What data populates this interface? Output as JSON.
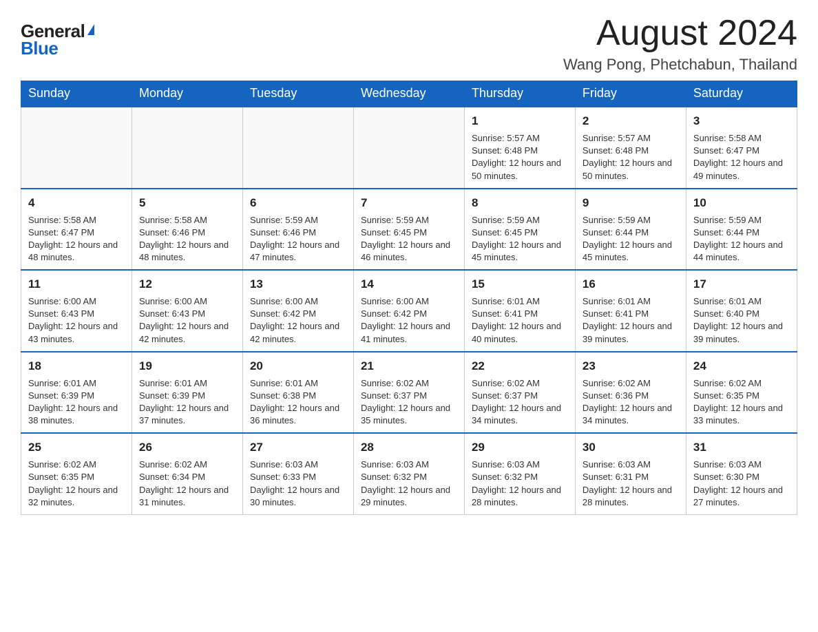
{
  "header": {
    "logo_general": "General",
    "logo_blue": "Blue",
    "month_title": "August 2024",
    "location": "Wang Pong, Phetchabun, Thailand"
  },
  "weekdays": [
    "Sunday",
    "Monday",
    "Tuesday",
    "Wednesday",
    "Thursday",
    "Friday",
    "Saturday"
  ],
  "weeks": [
    [
      {
        "day": "",
        "info": ""
      },
      {
        "day": "",
        "info": ""
      },
      {
        "day": "",
        "info": ""
      },
      {
        "day": "",
        "info": ""
      },
      {
        "day": "1",
        "info": "Sunrise: 5:57 AM\nSunset: 6:48 PM\nDaylight: 12 hours and 50 minutes."
      },
      {
        "day": "2",
        "info": "Sunrise: 5:57 AM\nSunset: 6:48 PM\nDaylight: 12 hours and 50 minutes."
      },
      {
        "day": "3",
        "info": "Sunrise: 5:58 AM\nSunset: 6:47 PM\nDaylight: 12 hours and 49 minutes."
      }
    ],
    [
      {
        "day": "4",
        "info": "Sunrise: 5:58 AM\nSunset: 6:47 PM\nDaylight: 12 hours and 48 minutes."
      },
      {
        "day": "5",
        "info": "Sunrise: 5:58 AM\nSunset: 6:46 PM\nDaylight: 12 hours and 48 minutes."
      },
      {
        "day": "6",
        "info": "Sunrise: 5:59 AM\nSunset: 6:46 PM\nDaylight: 12 hours and 47 minutes."
      },
      {
        "day": "7",
        "info": "Sunrise: 5:59 AM\nSunset: 6:45 PM\nDaylight: 12 hours and 46 minutes."
      },
      {
        "day": "8",
        "info": "Sunrise: 5:59 AM\nSunset: 6:45 PM\nDaylight: 12 hours and 45 minutes."
      },
      {
        "day": "9",
        "info": "Sunrise: 5:59 AM\nSunset: 6:44 PM\nDaylight: 12 hours and 45 minutes."
      },
      {
        "day": "10",
        "info": "Sunrise: 5:59 AM\nSunset: 6:44 PM\nDaylight: 12 hours and 44 minutes."
      }
    ],
    [
      {
        "day": "11",
        "info": "Sunrise: 6:00 AM\nSunset: 6:43 PM\nDaylight: 12 hours and 43 minutes."
      },
      {
        "day": "12",
        "info": "Sunrise: 6:00 AM\nSunset: 6:43 PM\nDaylight: 12 hours and 42 minutes."
      },
      {
        "day": "13",
        "info": "Sunrise: 6:00 AM\nSunset: 6:42 PM\nDaylight: 12 hours and 42 minutes."
      },
      {
        "day": "14",
        "info": "Sunrise: 6:00 AM\nSunset: 6:42 PM\nDaylight: 12 hours and 41 minutes."
      },
      {
        "day": "15",
        "info": "Sunrise: 6:01 AM\nSunset: 6:41 PM\nDaylight: 12 hours and 40 minutes."
      },
      {
        "day": "16",
        "info": "Sunrise: 6:01 AM\nSunset: 6:41 PM\nDaylight: 12 hours and 39 minutes."
      },
      {
        "day": "17",
        "info": "Sunrise: 6:01 AM\nSunset: 6:40 PM\nDaylight: 12 hours and 39 minutes."
      }
    ],
    [
      {
        "day": "18",
        "info": "Sunrise: 6:01 AM\nSunset: 6:39 PM\nDaylight: 12 hours and 38 minutes."
      },
      {
        "day": "19",
        "info": "Sunrise: 6:01 AM\nSunset: 6:39 PM\nDaylight: 12 hours and 37 minutes."
      },
      {
        "day": "20",
        "info": "Sunrise: 6:01 AM\nSunset: 6:38 PM\nDaylight: 12 hours and 36 minutes."
      },
      {
        "day": "21",
        "info": "Sunrise: 6:02 AM\nSunset: 6:37 PM\nDaylight: 12 hours and 35 minutes."
      },
      {
        "day": "22",
        "info": "Sunrise: 6:02 AM\nSunset: 6:37 PM\nDaylight: 12 hours and 34 minutes."
      },
      {
        "day": "23",
        "info": "Sunrise: 6:02 AM\nSunset: 6:36 PM\nDaylight: 12 hours and 34 minutes."
      },
      {
        "day": "24",
        "info": "Sunrise: 6:02 AM\nSunset: 6:35 PM\nDaylight: 12 hours and 33 minutes."
      }
    ],
    [
      {
        "day": "25",
        "info": "Sunrise: 6:02 AM\nSunset: 6:35 PM\nDaylight: 12 hours and 32 minutes."
      },
      {
        "day": "26",
        "info": "Sunrise: 6:02 AM\nSunset: 6:34 PM\nDaylight: 12 hours and 31 minutes."
      },
      {
        "day": "27",
        "info": "Sunrise: 6:03 AM\nSunset: 6:33 PM\nDaylight: 12 hours and 30 minutes."
      },
      {
        "day": "28",
        "info": "Sunrise: 6:03 AM\nSunset: 6:32 PM\nDaylight: 12 hours and 29 minutes."
      },
      {
        "day": "29",
        "info": "Sunrise: 6:03 AM\nSunset: 6:32 PM\nDaylight: 12 hours and 28 minutes."
      },
      {
        "day": "30",
        "info": "Sunrise: 6:03 AM\nSunset: 6:31 PM\nDaylight: 12 hours and 28 minutes."
      },
      {
        "day": "31",
        "info": "Sunrise: 6:03 AM\nSunset: 6:30 PM\nDaylight: 12 hours and 27 minutes."
      }
    ]
  ]
}
